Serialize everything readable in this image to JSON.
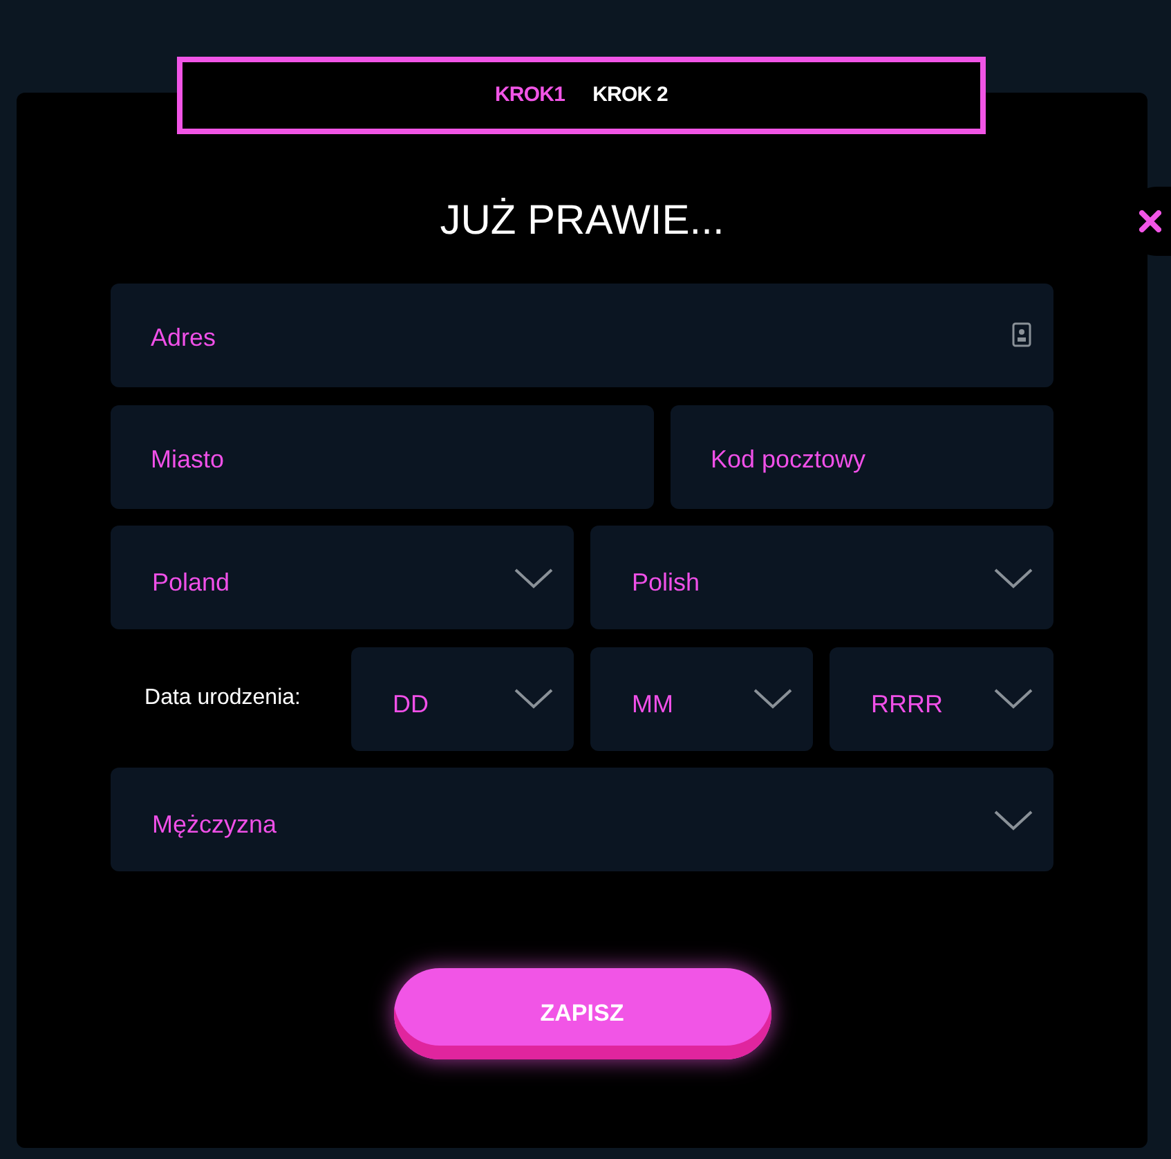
{
  "steps": [
    {
      "label": "KROK1",
      "selected": true
    },
    {
      "label": "KROK 2",
      "selected": false
    }
  ],
  "title": "JUŻ PRAWIE...",
  "address": {
    "placeholder": "Adres"
  },
  "city": {
    "placeholder": "Miasto"
  },
  "postal_code": {
    "placeholder": "Kod pocztowy"
  },
  "country": {
    "value": "Poland"
  },
  "language": {
    "value": "Polish"
  },
  "birth_date": {
    "label": "Data urodzenia:",
    "day": "DD",
    "month": "MM",
    "year": "RRRR"
  },
  "gender": {
    "value": "Mężczyzna"
  },
  "save_button": "ZAPISZ"
}
